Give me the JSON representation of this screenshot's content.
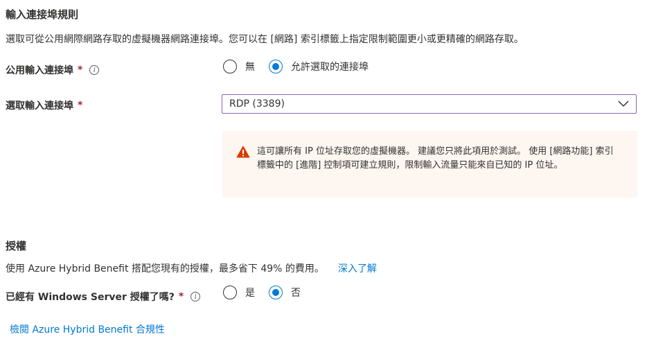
{
  "ports": {
    "title": "輸入連接埠規則",
    "description": "選取可從公用網際網路存取的虛擬機器網路連接埠。您可以在 [網路] 索引標籤上指定限制範圍更小或更精確的網路存取。",
    "public_ports_label": "公用輸入連接埠",
    "public_ports_options": [
      {
        "label": "無",
        "selected": false
      },
      {
        "label": "允許選取的連接埠",
        "selected": true
      }
    ],
    "select_ports_label": "選取輸入連接埠",
    "select_ports_value": "RDP (3389)",
    "warning_text": "這可讓所有 IP 位址存取您的虛擬機器。 建議您只將此項用於測試。 使用 [網路功能] 索引標籤中的 [進階] 控制項可建立規則，限制輸入流量只能來自已知的 IP 位址。"
  },
  "license": {
    "title": "授權",
    "description": "使用 Azure Hybrid Benefit 搭配您現有的授權，最多省下 49% 的費用。",
    "learn_more": "深入了解",
    "question_label": "已經有 Windows Server 授權了嗎?",
    "options": [
      {
        "label": "是",
        "selected": false
      },
      {
        "label": "否",
        "selected": true
      }
    ],
    "compliance_link": "檢閱 Azure Hybrid Benefit 合規性"
  },
  "common": {
    "required_mark": "*",
    "info_glyph": "i",
    "accent_color": "#0078d4",
    "required_color": "#a4262c",
    "warning_color": "#d83b01"
  }
}
